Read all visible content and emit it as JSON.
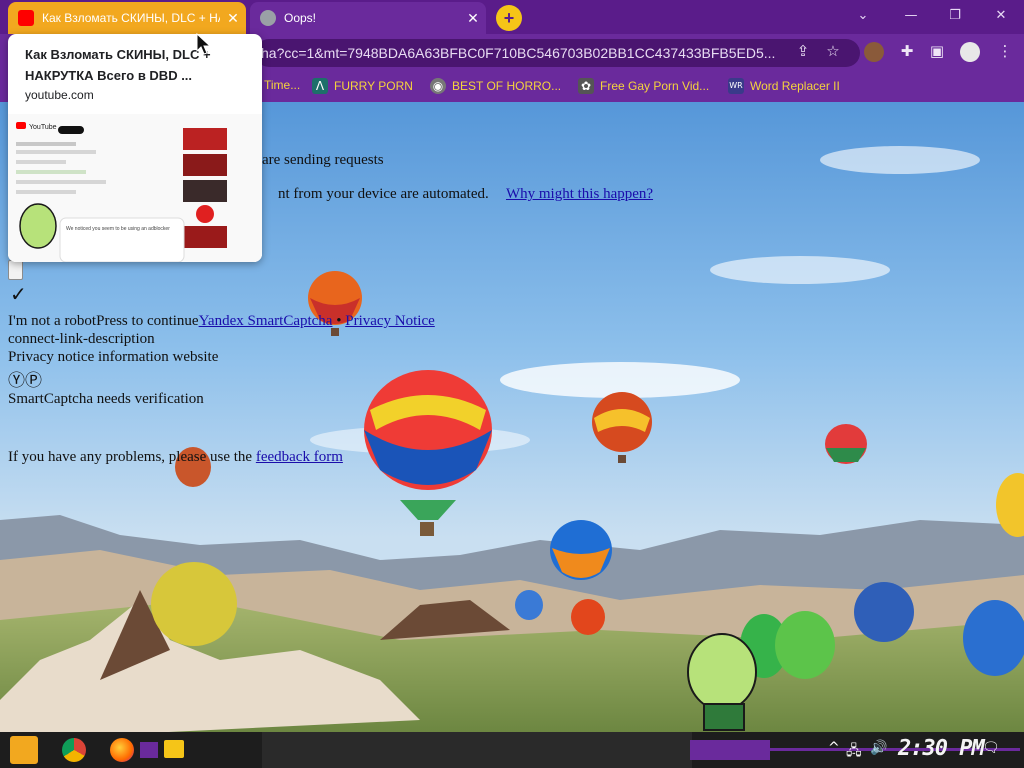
{
  "browser": {
    "tabs": [
      {
        "title": "Как Взломать СКИНЫ, DLC + НАКРУТКА Всего в DBD ...",
        "close": "✕",
        "active": true,
        "favicon_color": "#ff0000"
      },
      {
        "title": "Oops!",
        "close": "✕",
        "active": false,
        "favicon_color": "#9aa0a6"
      }
    ],
    "new_tab": "+",
    "window_controls": {
      "dropdown": "⌄",
      "minimize": "—",
      "restore": "❐",
      "close": "✕"
    },
    "omnibox": {
      "url": "ha?cc=1&mt=7948BDA6A63BFBC0F710BC546703B02BB1CC437433BFB5ED5..."
    },
    "toolbar_icons": {
      "share": "⇪",
      "bookmark": "☆",
      "extensions": "✚",
      "sidepanel": "▣",
      "menu": "⋮"
    }
  },
  "bookmarks": [
    {
      "label": "Time...",
      "icon": ""
    },
    {
      "label": "FURRY PORN",
      "icon": "Λ"
    },
    {
      "label": "BEST OF HORRO...",
      "icon": "◉"
    },
    {
      "label": "Free Gay Porn Vid...",
      "icon": "✿"
    },
    {
      "label": "Word Replacer II",
      "icon": "WR"
    }
  ],
  "hovercard": {
    "title": "Как Взломать СКИНЫ, DLC + НАКРУТКА Всего в DBD ...",
    "domain": "youtube.com",
    "thumb_brand": "YouTube",
    "thumb_popup": "We noticed you seem to be using an adblocker"
  },
  "captcha": {
    "line1_visible": "are sending requests",
    "line2_visible": "nt from your device are automated.",
    "why_link": "Why might this happen?",
    "checkmark": "✓",
    "robot_text": "I'm not a robotPress to continue",
    "smartcaptcha_link": "Yandex SmartCaptcha",
    "separator": " • ",
    "privacy_link": "Privacy Notice",
    "connect_desc": "connect-link-description",
    "privacy_info": "Privacy notice information website",
    "logos": "ⓎⓅ",
    "needs_verification": "SmartCaptcha needs verification",
    "problems_text": "If you have any problems, please use the ",
    "feedback_link": "feedback form"
  },
  "taskbar": {
    "clock": "2:30 PM",
    "tray": {
      "chevron": "^",
      "network": "🖧",
      "volume": "🔊",
      "notifications": "🗨"
    }
  }
}
